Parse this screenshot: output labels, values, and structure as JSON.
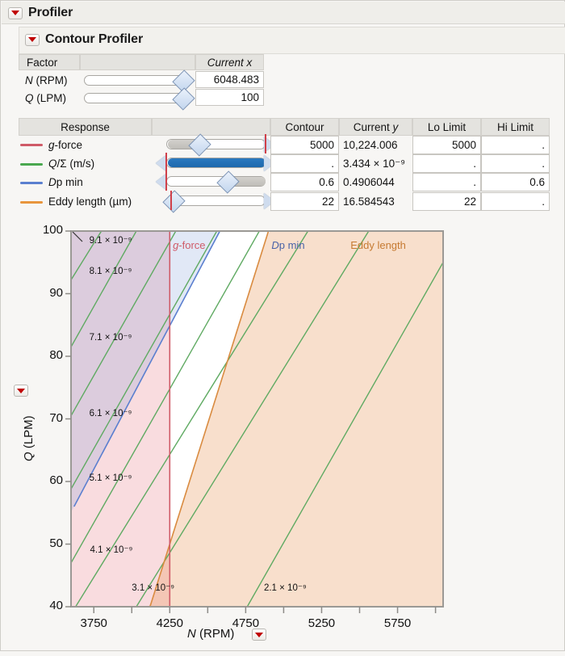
{
  "window": {
    "title": "Profiler",
    "subtitle": "Contour Profiler",
    "disclosure_icon": "red-triangle-icon"
  },
  "factor_table": {
    "headers": [
      "Factor",
      "",
      "Current x"
    ],
    "rows": [
      {
        "name": "N (RPM)",
        "name_italic": "N",
        "name_rest": " (RPM)",
        "current_x": "6048.483",
        "slider_pos": 0.93
      },
      {
        "name": "Q (LPM)",
        "name_italic": "Q",
        "name_rest": " (LPM)",
        "current_x": "100",
        "slider_pos": 0.93
      }
    ]
  },
  "response_table": {
    "headers": [
      "Response",
      "",
      "Contour",
      "Current y",
      "Lo Limit",
      "Hi Limit"
    ],
    "rows": [
      {
        "label": "g-force",
        "label_italic": "g",
        "label_rest": "-force",
        "color": "#cf5b68",
        "contour": "5000",
        "current_y": "10,224.006",
        "lo_limit": "5000",
        "hi_limit": ".",
        "handle_pos": 0.34,
        "fill_from": 0.0,
        "fill_to": 0.34,
        "arrow_right": true,
        "arrow_left": false,
        "lim_left": false,
        "lim_right": true
      },
      {
        "label": "Q/Σ (m/s)",
        "label_italic": "Q",
        "label_rest": "/Σ (m/s)",
        "color": "#4aa84f",
        "contour": ".",
        "current_y": "3.434 × 10⁻⁹",
        "lo_limit": ".",
        "hi_limit": ".",
        "handle_pos": -1,
        "fill_from": 0.0,
        "fill_to": 1.0,
        "arrow_right": true,
        "arrow_left": true,
        "lim_left": true,
        "lim_right": false,
        "fill_blue": true
      },
      {
        "label": "Dp min",
        "label_italic": "D",
        "label_rest": "p min",
        "color": "#5b7fcf",
        "contour": "0.6",
        "current_y": "0.4906044",
        "lo_limit": ".",
        "hi_limit": "0.6",
        "handle_pos": 0.63,
        "fill_from": 0.63,
        "fill_to": 1.0,
        "arrow_right": false,
        "arrow_left": true,
        "lim_left": true,
        "lim_right": false
      },
      {
        "label": "Eddy length (µm)",
        "label_italic": "",
        "label_rest": "Eddy length (µm)",
        "color": "#e8953c",
        "contour": "22",
        "current_y": "16.584543",
        "lo_limit": "22",
        "hi_limit": ".",
        "handle_pos": 0.06,
        "fill_from": 0.0,
        "fill_to": 0.05,
        "arrow_right": true,
        "arrow_left": false,
        "lim_left": false,
        "lim_right": false,
        "lim_at_handle": true
      }
    ]
  },
  "chart_data": {
    "type": "contour",
    "title": "",
    "xlabel": "N (RPM)",
    "xlabel_italic": "N",
    "xlabel_rest": " (RPM)",
    "ylabel": "Q (LPM)",
    "ylabel_italic": "Q",
    "ylabel_rest": " (LPM)",
    "xlim": [
      3600,
      6050
    ],
    "ylim": [
      40,
      100
    ],
    "xticks": [
      3750,
      4250,
      4750,
      5250,
      5750
    ],
    "xtick_labels": [
      "3750",
      "4250",
      "4750",
      "5250",
      "5750"
    ],
    "yticks": [
      40,
      50,
      60,
      70,
      80,
      90,
      100
    ],
    "ytick_labels": [
      "40",
      "50",
      "60",
      "70",
      "80",
      "90",
      "100"
    ],
    "grid": false,
    "contour_labels": [
      {
        "text": "9.1 × 10⁻⁹",
        "x": 3720,
        "y": 98.4
      },
      {
        "text": "8.1 × 10⁻⁹",
        "x": 3720,
        "y": 93.6
      },
      {
        "text": "7.1 × 10⁻⁹",
        "x": 3720,
        "y": 83.0
      },
      {
        "text": "6.1 × 10⁻⁹",
        "x": 3720,
        "y": 70.8
      },
      {
        "text": "5.1 × 10⁻⁹",
        "x": 3720,
        "y": 60.5
      },
      {
        "text": "4.1 × 10⁻⁹",
        "x": 3725,
        "y": 49.0
      },
      {
        "text": "3.1 × 10⁻⁹",
        "x": 4000,
        "y": 43.0
      },
      {
        "text": "2.1 × 10⁻⁹",
        "x": 4870,
        "y": 43.0
      }
    ],
    "region_labels": [
      {
        "text": "g-force",
        "text_italic": "g",
        "text_rest": "-force",
        "color": "#cf5b68",
        "x": 4270,
        "y": 97.6
      },
      {
        "text": "Dp min",
        "text_italic": "D",
        "text_rest": "p min",
        "color": "#4a63a8",
        "x": 4920,
        "y": 97.6
      },
      {
        "text": "Eddy length",
        "text_italic": "",
        "text_rest": "Eddy length",
        "color": "#c67a32",
        "x": 5440,
        "y": 97.6
      }
    ],
    "series": [
      {
        "name": "g-force",
        "color": "#cf5b68",
        "kind": "vertical-limit",
        "value": 4250,
        "shade_side": "left",
        "shade_color": "rgba(232,120,130,0.26)"
      },
      {
        "name": "Dp min",
        "color": "#5b7fcf",
        "kind": "line",
        "p1": [
          3620,
          56.0
        ],
        "p2": [
          4580,
          100.0
        ],
        "shade_side": "left",
        "shade_color": "rgba(120,150,215,0.22)"
      },
      {
        "name": "Eddy length",
        "color": "#d98b40",
        "kind": "line",
        "p1": [
          4120,
          40.0
        ],
        "p2": [
          4900,
          100.0
        ],
        "shade_side": "right",
        "shade_color": "rgba(232,150,85,0.30)"
      },
      {
        "name": "Q/Σ (m/s)",
        "color": "#5faa62",
        "kind": "contour-family",
        "lines": [
          {
            "label": "9.1e-9",
            "p1": [
              3600,
              92.2
            ],
            "p2": [
              3800,
              100.0
            ]
          },
          {
            "label": "8.1e-9",
            "p1": [
              3600,
              81.5
            ],
            "p2": [
              4030,
              100.0
            ]
          },
          {
            "label": "7.1e-9",
            "p1": [
              3600,
              70.5
            ],
            "p2": [
              4290,
              100.0
            ]
          },
          {
            "label": "6.1e-9",
            "p1": [
              3600,
              58.8
            ],
            "p2": [
              4560,
              100.0
            ]
          },
          {
            "label": "5.1e-9",
            "p1": [
              3600,
              47.0
            ],
            "p2": [
              4840,
              100.0
            ]
          },
          {
            "label": "4.1e-9",
            "p1": [
              3630,
              40.0
            ],
            "p2": [
              5160,
              100.0
            ]
          },
          {
            "label": "3.1e-9",
            "p1": [
              4030,
              40.0
            ],
            "p2": [
              5560,
              100.0
            ]
          },
          {
            "label": "2.1e-9",
            "p1": [
              4760,
              40.0
            ],
            "p2": [
              6050,
              95.0
            ]
          }
        ]
      }
    ]
  }
}
